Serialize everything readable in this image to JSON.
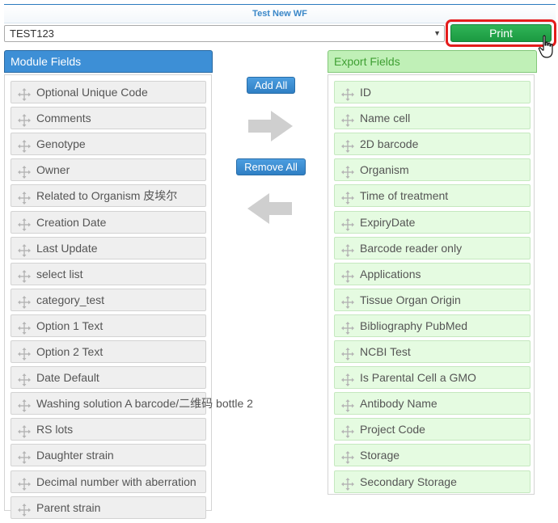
{
  "workflow": {
    "title": "Test New WF",
    "selected_value": "TEST123",
    "print_label": "Print"
  },
  "module_fields": {
    "title": "Module Fields",
    "items": [
      "Optional Unique Code",
      "Comments",
      "Genotype",
      "Owner",
      "Related to Organism 皮埃尔",
      "Creation Date",
      "Last Update",
      "select list",
      "category_test",
      "Option 1 Text",
      "Option 2 Text",
      "Date Default",
      "Washing solution A barcode/二维码 bottle 2",
      "RS lots",
      "Daughter strain",
      "Decimal number with aberration",
      "Parent strain"
    ]
  },
  "controls": {
    "add_all_label": "Add All",
    "remove_all_label": "Remove All"
  },
  "export_fields": {
    "title": "Export Fields",
    "items": [
      "ID",
      "Name cell",
      "2D barcode",
      "Organism",
      "Time of treatment",
      "ExpiryDate",
      "Barcode reader only",
      "Applications",
      "Tissue Organ Origin",
      "Bibliography PubMed",
      "NCBI Test",
      "Is Parental Cell a GMO",
      "Antibody Name",
      "Project Code",
      "Storage",
      "Secondary Storage"
    ]
  },
  "icons": {
    "move": "move-icon",
    "arrow_right": "arrow-right-icon",
    "arrow_left": "arrow-left-icon",
    "dropdown": "chevron-down-icon",
    "cursor": "hand-pointer-icon"
  },
  "colors": {
    "module_header": "#3d8fd6",
    "export_header": "#c0f0b7",
    "print_button": "#1c9a41",
    "highlight_border": "#e41c1c"
  }
}
